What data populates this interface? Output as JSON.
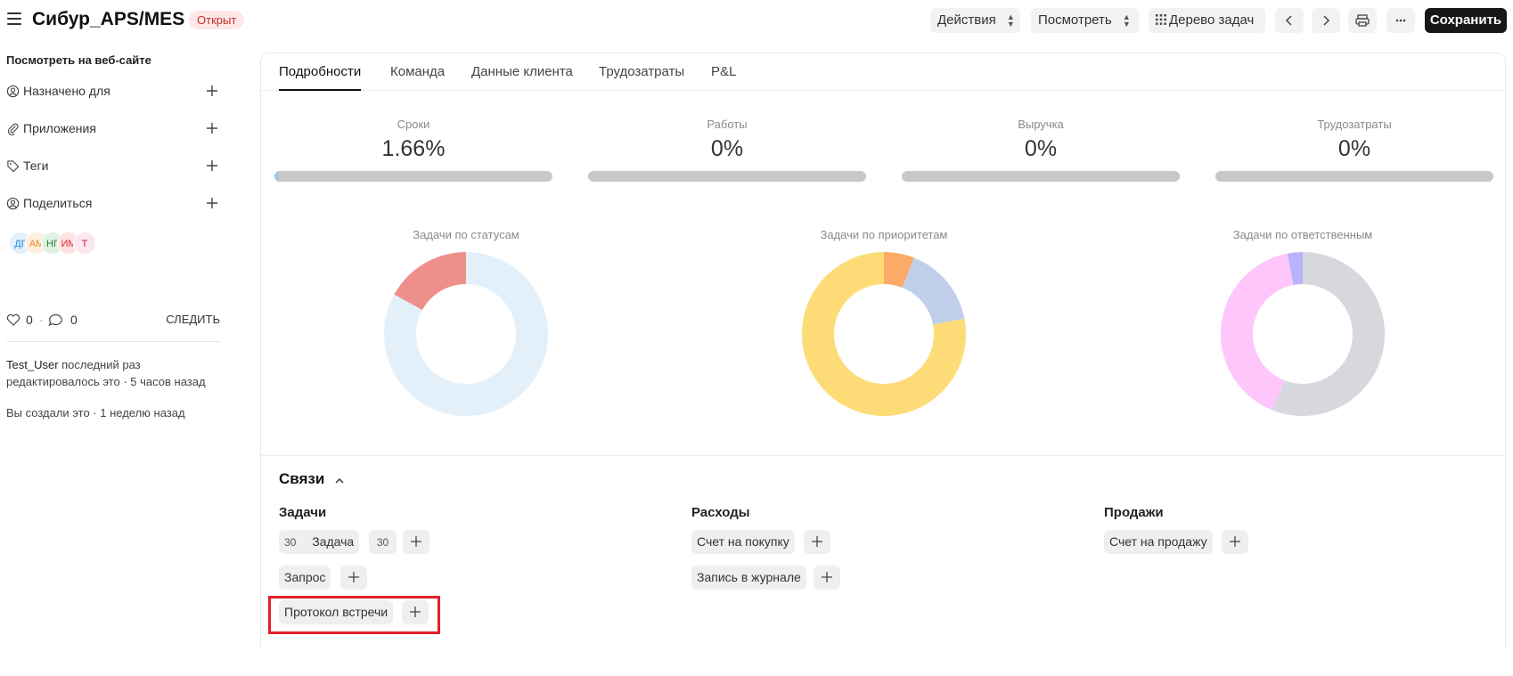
{
  "header": {
    "title": "Сибур_APS/MES",
    "status": "Открыт",
    "actions_label": "Действия",
    "view_label": "Посмотреть",
    "task_tree_label": "Дерево задач",
    "save_label": "Сохранить"
  },
  "sidebar": {
    "website_link": "Посмотреть на веб-сайте",
    "rows": [
      {
        "label": "Назначено для",
        "icon": "user-assign-icon"
      },
      {
        "label": "Приложения",
        "icon": "paperclip-icon"
      },
      {
        "label": "Теги",
        "icon": "tag-icon"
      },
      {
        "label": "Поделиться",
        "icon": "share-user-icon"
      }
    ],
    "avatars": [
      {
        "initials": "ДГ",
        "color": "#1e88e5",
        "bg": "#e3f0fc"
      },
      {
        "initials": "АМ",
        "color": "#e6862d",
        "bg": "#fdeedd"
      },
      {
        "initials": "НГ",
        "color": "#2e7d32",
        "bg": "#dff1e0"
      },
      {
        "initials": "ИМ",
        "color": "#d32f2f",
        "bg": "#fde3e3"
      },
      {
        "initials": "Т",
        "color": "#c2185b",
        "bg": "#fde7ef"
      }
    ],
    "likes": "0",
    "comments": "0",
    "follow_label": "СЛЕДИТЬ",
    "edit_user": "Test_User",
    "edit_text_1": " последний раз",
    "edit_text_2": "редактировалось это · 5 часов назад",
    "created_text": "Вы создали это · 1 неделю назад"
  },
  "tabs": [
    {
      "label": "Подробности",
      "active": true
    },
    {
      "label": "Команда",
      "active": false
    },
    {
      "label": "Данные клиента",
      "active": false
    },
    {
      "label": "Трудозатраты",
      "active": false
    },
    {
      "label": "P&L",
      "active": false
    }
  ],
  "metrics": [
    {
      "label": "Сроки",
      "value": "1.66%",
      "progress": 0.0166
    },
    {
      "label": "Работы",
      "value": "0%",
      "progress": 0
    },
    {
      "label": "Выручка",
      "value": "0%",
      "progress": 0
    },
    {
      "label": "Трудозатраты",
      "value": "0%",
      "progress": 0
    }
  ],
  "charts": {
    "status": {
      "title": "Задачи по статусам"
    },
    "priority": {
      "title": "Задачи по приоритетам"
    },
    "owner": {
      "title": "Задачи по ответственным"
    }
  },
  "chart_data": [
    {
      "type": "pie",
      "title": "Задачи по статусам",
      "values": [
        83,
        17
      ],
      "colors": [
        "#e3f0fa",
        "#ef8f8c"
      ]
    },
    {
      "type": "pie",
      "title": "Задачи по приоритетам",
      "values": [
        6,
        16,
        78
      ],
      "colors": [
        "#fbaa67",
        "#bfcfe9",
        "#fddc78"
      ]
    },
    {
      "type": "pie",
      "title": "Задачи по ответственным",
      "values": [
        56,
        41,
        3
      ],
      "colors": [
        "#d6d8de",
        "#fec6fb",
        "#b9b3fb"
      ]
    }
  ],
  "links": {
    "title": "Связи",
    "tasks": {
      "title": "Задачи",
      "task_count_before": "30",
      "task_label": "Задача",
      "task_count_after": "30",
      "request_label": "Запрос",
      "meeting_label": "Протокол встречи"
    },
    "expenses": {
      "title": "Расходы",
      "purchase_invoice": "Счет на покупку",
      "journal_entry": "Запись в журнале"
    },
    "sales": {
      "title": "Продажи",
      "sales_invoice": "Счет на продажу"
    }
  }
}
